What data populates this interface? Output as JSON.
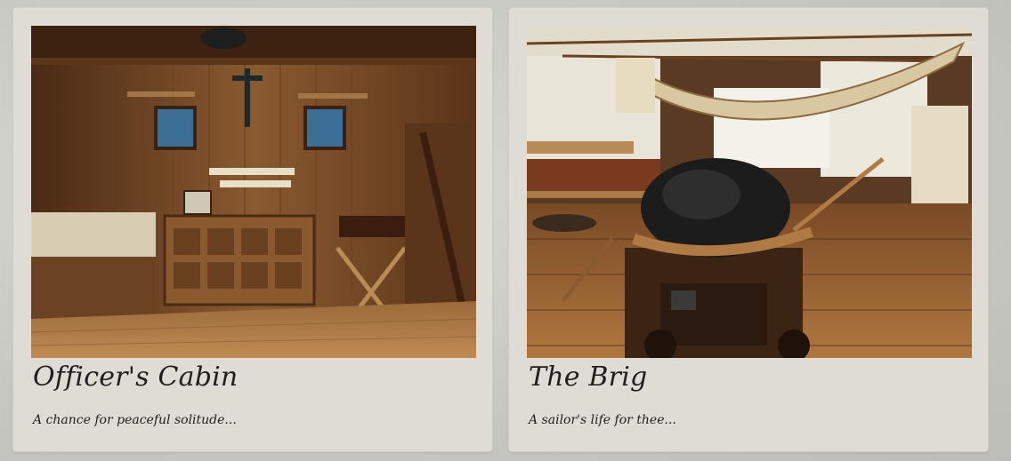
{
  "cards": [
    {
      "title": "Officer's Cabin",
      "caption": "A chance for peaceful solitude...",
      "image_subject": "officer-cabin-photo"
    },
    {
      "title": "The Brig",
      "caption": "A sailor's life for thee...",
      "image_subject": "brig-cannon-photo"
    }
  ],
  "colors": {
    "page_background": "#c9c9c3",
    "card_background": "#dedcd4",
    "text": "#1f1f1f"
  }
}
